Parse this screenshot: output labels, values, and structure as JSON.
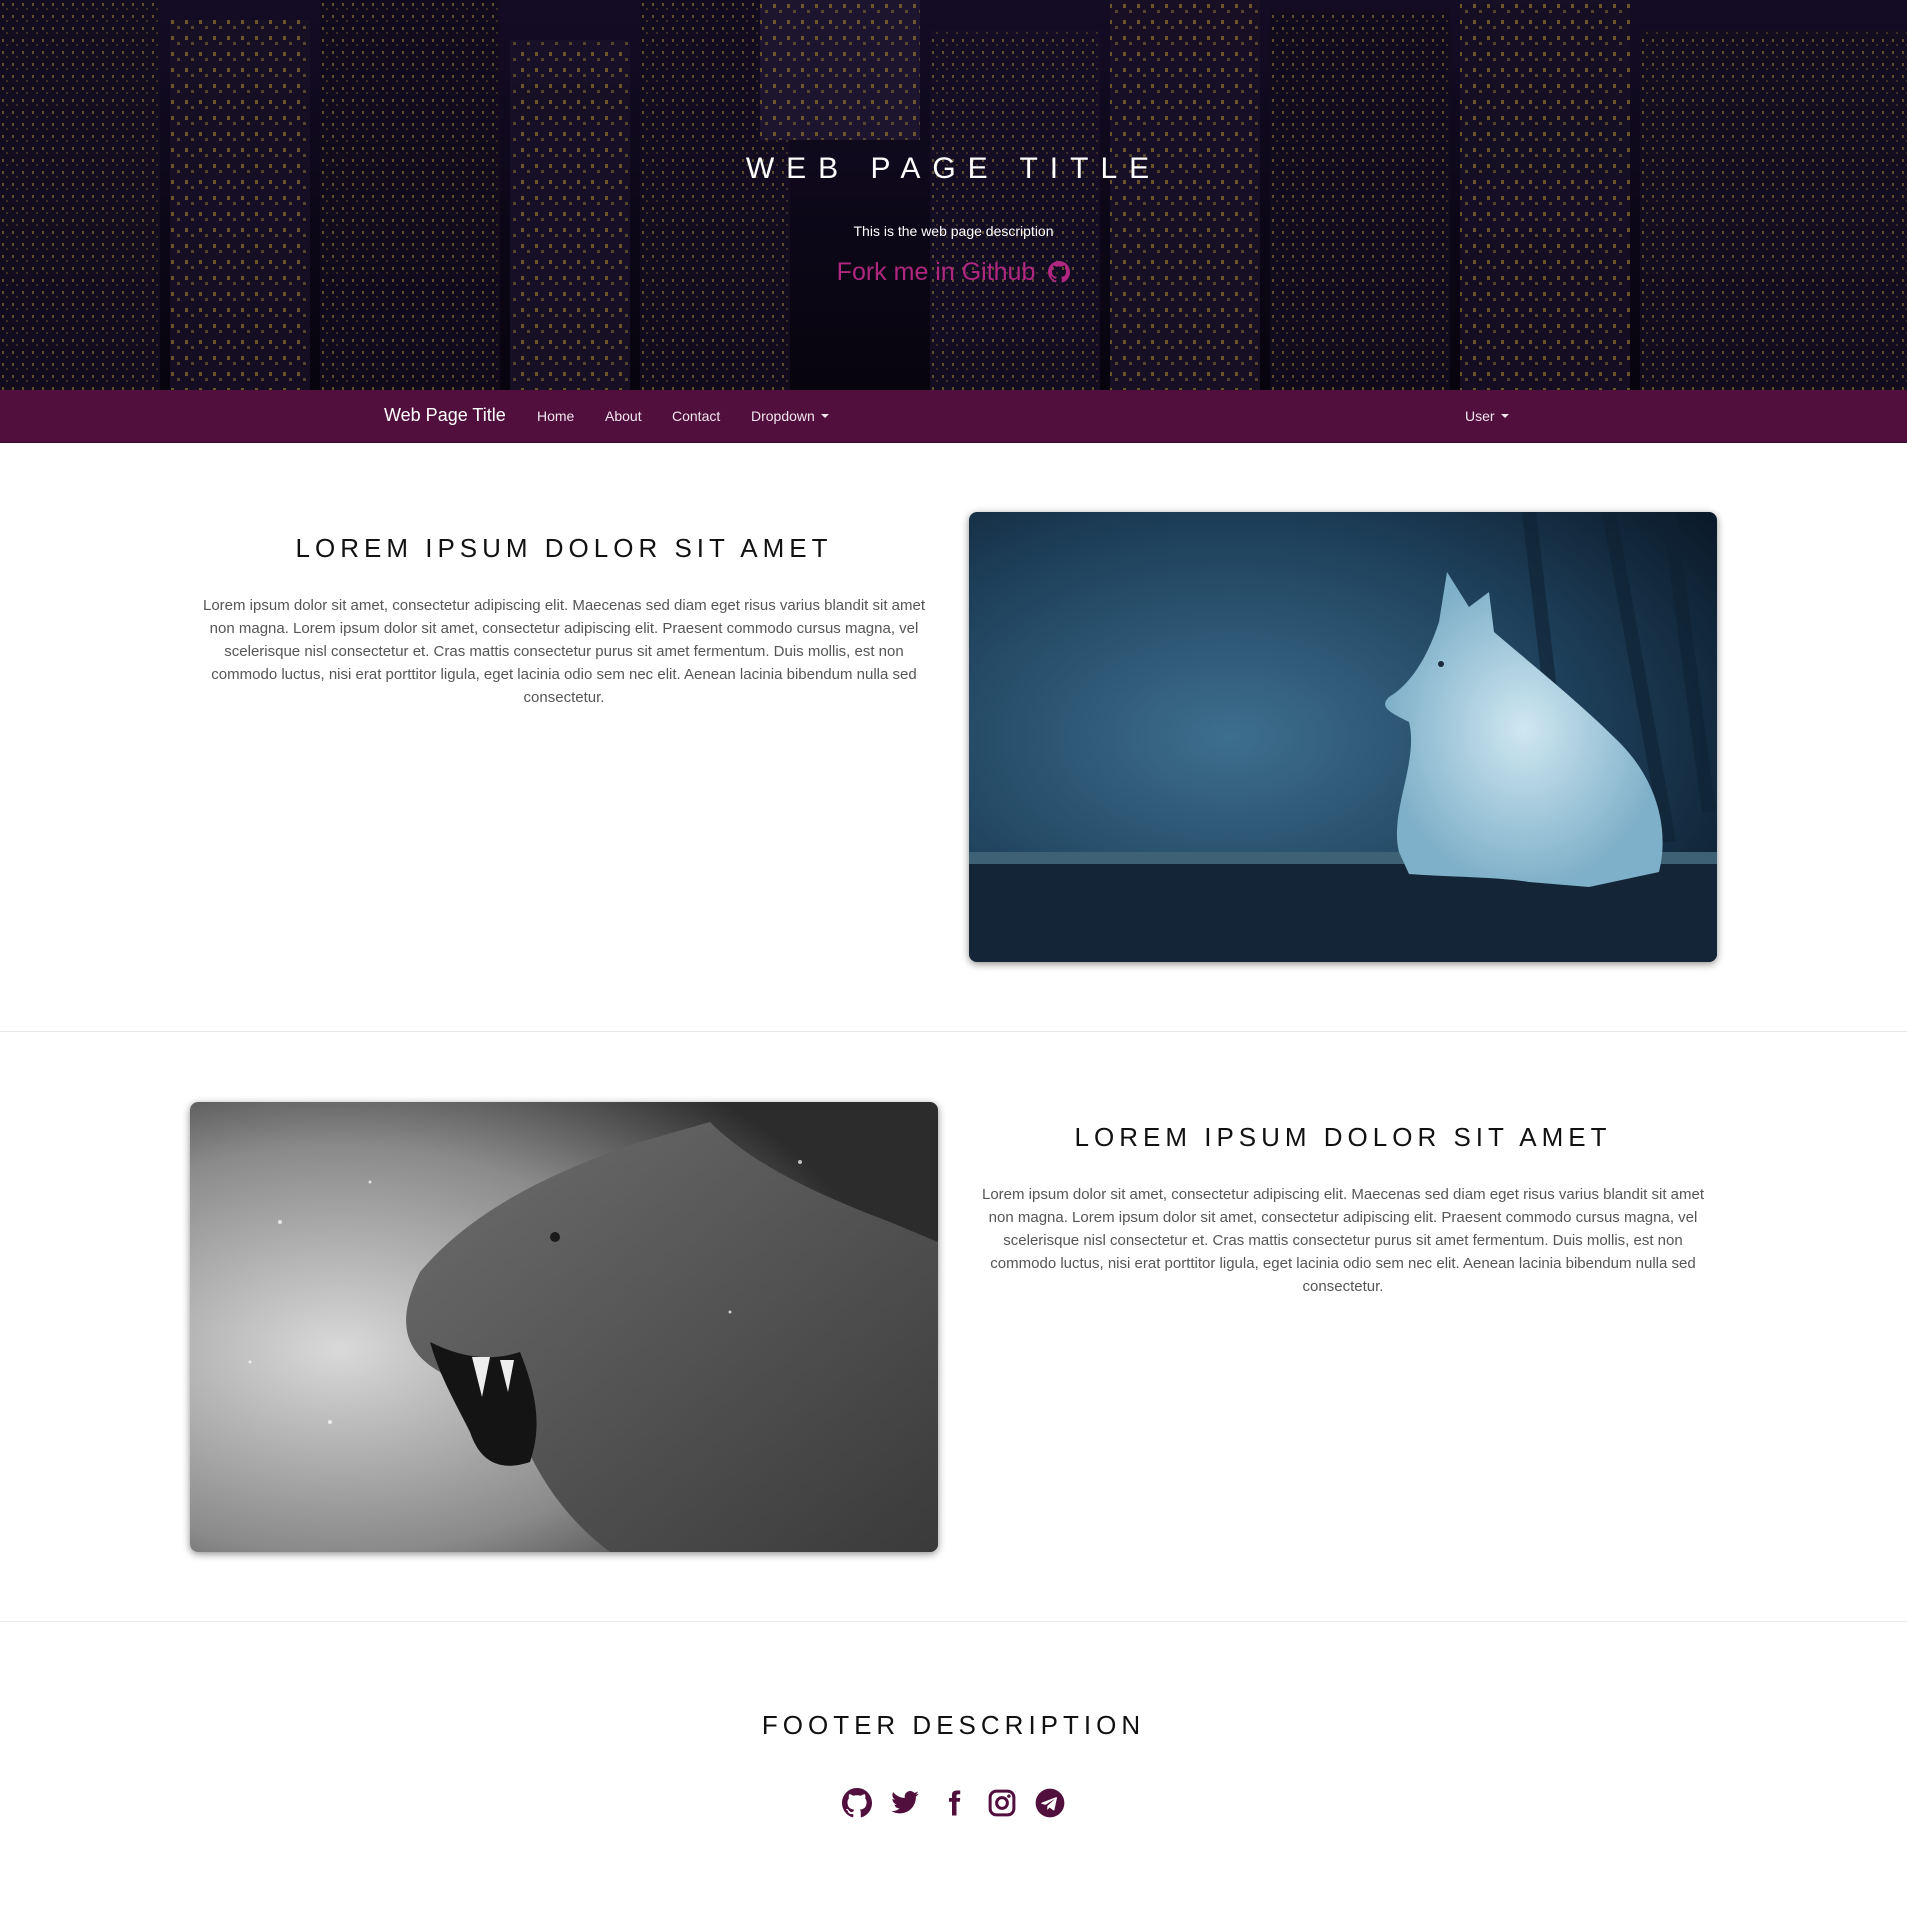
{
  "hero": {
    "title": "WEB PAGE TITLE",
    "description": "This is the web page description",
    "fork_link": "Fork me in Github",
    "fork_icon": "github-icon"
  },
  "navbar": {
    "brand": "Web Page Title",
    "items": [
      {
        "label": "Home"
      },
      {
        "label": "About"
      },
      {
        "label": "Contact"
      },
      {
        "label": "Dropdown"
      }
    ],
    "user": "User",
    "bg_color": "#510f3d"
  },
  "sections": [
    {
      "heading": "LOREM IPSUM DOLOR SIT AMET",
      "body": "Lorem ipsum dolor sit amet, consectetur adipiscing elit. Maecenas sed diam eget risus varius blandit sit amet non magna. Lorem ipsum dolor sit amet, consectetur adipiscing elit. Praesent commodo cursus magna, vel scelerisque nisl consectetur et. Cras mattis consectetur purus sit amet fermentum. Duis mollis, est non commodo luctus, nisi erat porttitor ligula, eget lacinia odio sem nec elit. Aenean lacinia bibendum nulla sed consectetur.",
      "image": "white-wolf-photo"
    },
    {
      "heading": "LOREM IPSUM DOLOR SIT AMET",
      "body": "Lorem ipsum dolor sit amet, consectetur adipiscing elit. Maecenas sed diam eget risus varius blandit sit amet non magna. Lorem ipsum dolor sit amet, consectetur adipiscing elit. Praesent commodo cursus magna, vel scelerisque nisl consectetur et. Cras mattis consectetur purus sit amet fermentum. Duis mollis, est non commodo luctus, nisi erat porttitor ligula, eget lacinia odio sem nec elit. Aenean lacinia bibendum nulla sed consectetur.",
      "image": "roaring-lioness-photo"
    }
  ],
  "footer": {
    "title": "FOOTER DESCRIPTION",
    "socials": [
      "github-icon",
      "twitter-icon",
      "facebook-icon",
      "instagram-icon",
      "telegram-icon"
    ],
    "icon_color": "#510f3d"
  },
  "colors": {
    "accent": "#b0277f",
    "navbar": "#510f3d"
  }
}
